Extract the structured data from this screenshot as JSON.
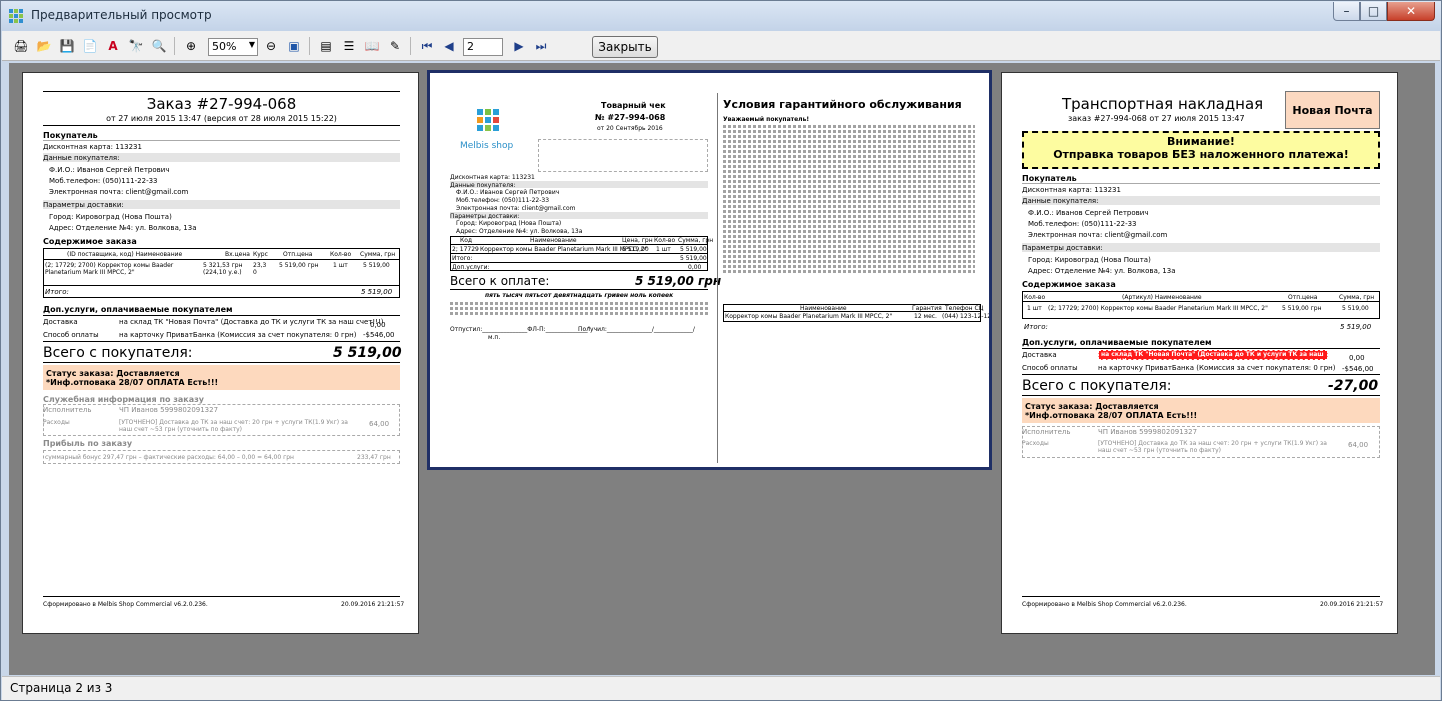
{
  "window": {
    "title": "Предварительный просмотр",
    "min": "–",
    "max": "□",
    "close": "✕"
  },
  "toolbar": {
    "zoom_value": "50%",
    "page_value": "2",
    "close_label": "Закрыть",
    "icons": [
      "print-icon",
      "open-icon",
      "save-icon",
      "export-icon",
      "pdf-icon",
      "find-icon",
      "search-icon",
      "zoom-in-icon",
      "zoom-out-icon",
      "fit-page-icon",
      "page-setup-icon",
      "outline-icon",
      "thumbnails-icon",
      "edit-icon",
      "first-page-icon",
      "prev-page-icon",
      "next-page-icon",
      "last-page-icon"
    ]
  },
  "status": {
    "text": "Страница 2 из 3"
  },
  "page1": {
    "title": "Заказ #27-994-068",
    "subtitle": "от 27 июля 2015 13:47 (версия от 28 июля 2015 15:22)",
    "buyer_h": "Покупатель",
    "card": "Дисконтная карта: 113231",
    "buyer_data_h": "Данные покупателя:",
    "fio": "Ф.И.О.: Иванов Сергей Петрович",
    "phone": "Моб.телефон: (050)111-22-33",
    "email": "Электронная почта: client@gmail.com",
    "delivery_h": "Параметры доставки:",
    "city": "Город: Кировоград (Нова Пошта)",
    "address": "Адрес: Отделение №4: ул. Волкова, 13а",
    "content_h": "Содержимое заказа",
    "col1": "(ID поставщика, код) Наименование",
    "col2": "Вх.цена",
    "col3": "Курс",
    "col4": "Отп.цена",
    "col5": "Кол-во",
    "col6": "Сумма, грн",
    "item_name": "(2; 17729; 2700) Корректор комы Baader Planetarium Mark III MPCC, 2\"",
    "item_in": "5 321,53 грн (224,10 у.е.)",
    "item_rate": "23,3 0",
    "item_price": "5 519,00 грн",
    "item_qty": "1 шт",
    "item_sum": "5 519,00",
    "itogo": "Итого:",
    "itogo_val": "5 519,00",
    "extra_h": "Доп.услуги, оплачиваемые покупателем",
    "deliv_lbl": "Доставка",
    "deliv_val": "на склад ТК \"Новая Почта\" (Доставка до ТК и услуги ТК за наш счет!!!)",
    "deliv_sum": "0,00",
    "pay_lbl": "Способ оплаты",
    "pay_val": "на карточку ПриватБанка (Комиссия за счет покупателя: 0 грн)",
    "pay_sum": "-$546,00",
    "total_lbl": "Всего с покупателя:",
    "total_val": "5 519,00",
    "status1": "Статус заказа: Доставляется",
    "status2": "*Инф.отповака 28/07 ОПЛАТА Есть!!!",
    "service_h": "Служебная информация по заказу",
    "exec_lbl": "Исполнитель",
    "exec_val": "ЧП Иванов 5999802091327",
    "exp_lbl": "Расходы",
    "exp_val": "[УТОЧНЕНО] Доставка до ТК за наш счет: 20 грн + услуги ТК(1.9 Укг) за наш счет ~53 грн (уточнить по факту)",
    "exp_sum": "64,00",
    "profit_h": "Прибыль по заказу",
    "profit_val": "суммарный бонус 297,47 грн – фактические расходы: 64,00 – 0,00 = 64,00 грн",
    "profit_sum": "233,47 грн",
    "footer_left": "Сформировано в Melbis Shop Commercial v6.2.0.236.",
    "footer_right": "20.09.2016 21:21:57"
  },
  "page2": {
    "logo": "Melbis shop",
    "check_title": "Товарный чек",
    "check_no": "№ #27-994-068",
    "check_date": "от 20 Сентябрь 2016",
    "card": "Дисконтная карта: 113231",
    "buyer_data_h": "Данные покупателя:",
    "fio": "Ф.И.О.: Иванов Сергей Петрович",
    "phone": "Моб.телефон: (050)111-22-33",
    "email": "Электронная почта: client@gmail.com",
    "delivery_h": "Параметры доставки:",
    "city": "Город: Кировоград (Нова Пошта)",
    "address": "Адрес: Отделение №4: ул. Волкова, 13а",
    "th_code": "Код",
    "th_name": "Наименование",
    "th_price": "Цена, грн",
    "th_qty": "Кол-во",
    "th_sum": "Сумма, грн",
    "row_code": "2; 17729",
    "row_name": "Корректор комы Baader Planetarium Mark III MPCC, 2\"",
    "row_price": "5 519,00",
    "row_qty": "1 шт",
    "row_sum": "5 519,00",
    "itogo": "Итого:",
    "itogo_val": "5 519,00",
    "dop": "Доп.услуги:",
    "dop_val": "0,00",
    "pay_lbl": "Всего к оплате:",
    "pay_val": "5 519,00 грн",
    "words": "пять тысяч пятьсот девятнадцать гривен ноль копеек",
    "sig1": "Отпустил:_______________ФЛ-П:______________\"",
    "sig2": "Получил:_______________/_____________/",
    "mp": "м.п.",
    "warranty_title": "Условия гарантийного обслуживания",
    "warranty_greet": "Уважаемый покупатель!",
    "w_th1": "Наименование",
    "w_th2": "Гарантия",
    "w_th3": "Телефон СЦ",
    "w_row1": "Корректор комы Baader Planetarium Mark III MPCC, 2\"",
    "w_row2": "12 мес.",
    "w_row3": "(044) 123-12-12"
  },
  "page3": {
    "title": "Транспортная накладная",
    "subtitle": "заказ #27-994-068 от 27 июля 2015 13:47",
    "np": "Новая Почта",
    "warn1": "Внимание!",
    "warn2": "Отправка товаров БЕЗ наложенного платежа!",
    "buyer_h": "Покупатель",
    "card": "Дисконтная карта: 113231",
    "buyer_data_h": "Данные покупателя:",
    "fio": "Ф.И.О.: Иванов Сергей Петрович",
    "phone": "Моб.телефон: (050)111-22-33",
    "email": "Электронная почта: client@gmail.com",
    "delivery_h": "Параметры доставки:",
    "city": "Город: Кировоград (Нова Пошта)",
    "address": "Адрес: Отделение №4: ул. Волкова, 13а",
    "content_h": "Содержимое заказа",
    "th_qty": "Кол-во",
    "th_name": "(Артикул) Наименование",
    "th_price": "Отп.цена",
    "th_sum": "Сумма, грн",
    "row_qty": "1 шт",
    "row_name": "(2; 17729; 2700) Корректор комы Baader Planetarium Mark III MPCC, 2\"",
    "row_price": "5 519,00 грн",
    "row_sum": "5 519,00",
    "itogo": "Итого:",
    "itogo_val": "5 519,00",
    "extra_h": "Доп.услуги, оплачиваемые покупателем",
    "deliv_lbl": "Доставка",
    "deliv_val": "на склад ТК \"Новая Почта\" (Доставка до ТК и услуги ТК за наш счет!!!)",
    "deliv_sum": "0,00",
    "pay_lbl": "Способ оплаты",
    "pay_val": "на карточку ПриватБанка (Комиссия за счет покупателя: 0 грн)",
    "pay_sum": "-$546,00",
    "total_lbl": "Всего с покупателя:",
    "total_val": "-27,00",
    "status1": "Статус заказа: Доставляется",
    "status2": "*Инф.отповака 28/07 ОПЛАТА Есть!!!",
    "exec_lbl": "Исполнитель",
    "exec_val": "ЧП Иванов 5999802091327",
    "exp_lbl": "Расходы",
    "exp_val": "[УТОЧНЕНО] Доставка до ТК за наш счет: 20 грн + услуги ТК(1.9 Укг) за наш счет ~53 грн (уточнить по факту)",
    "exp_sum": "64,00",
    "footer_left": "Сформировано в Melbis Shop Commercial v6.2.0.236.",
    "footer_right": "20.09.2016 21:21:57"
  }
}
